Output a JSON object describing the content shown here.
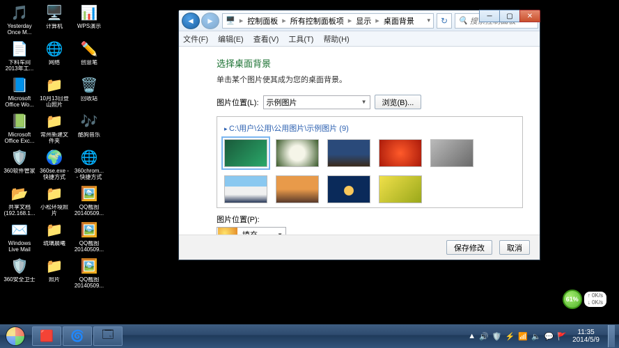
{
  "desktop": {
    "icons": [
      {
        "label": "Yesterday Once M...",
        "color": "#3a7ecb",
        "glyph": "🎵"
      },
      {
        "label": "计算机",
        "color": "#c8d0d8",
        "glyph": "🖥️"
      },
      {
        "label": "WPS演示",
        "color": "#d9542c",
        "glyph": "📊"
      },
      {
        "label": "下料车间2013年工...",
        "color": "#3a7ecb",
        "glyph": "📄"
      },
      {
        "label": "网络",
        "color": "#c8d0d8",
        "glyph": "🌐"
      },
      {
        "label": "创意笔",
        "color": "#2a3a5a",
        "glyph": "✏️"
      },
      {
        "label": "Microsoft Office Wo...",
        "color": "#3a7ecb",
        "glyph": "📘"
      },
      {
        "label": "10月13日登山照片",
        "color": "#f0c96a",
        "glyph": "📁"
      },
      {
        "label": "回收站",
        "color": "#c8d0d8",
        "glyph": "🗑️"
      },
      {
        "label": "Microsoft Office Exc...",
        "color": "#2a8a3a",
        "glyph": "📗"
      },
      {
        "label": "常州新建文件夹",
        "color": "#f0c96a",
        "glyph": "📁"
      },
      {
        "label": "酷狗音乐",
        "color": "#2a8aea",
        "glyph": "🎶"
      },
      {
        "label": "360软件管家",
        "color": "#3a5aea",
        "glyph": "🛡️"
      },
      {
        "label": "360se.exe - 快捷方式",
        "color": "#3aa84a",
        "glyph": "🌍"
      },
      {
        "label": "360chrom... - 快捷方式",
        "color": "#e8a83a",
        "glyph": "🌐"
      },
      {
        "label": "共享文档(192.168.1...",
        "color": "#3a7ecb",
        "glyph": "📂"
      },
      {
        "label": "小松环境照片",
        "color": "#f0c96a",
        "glyph": "📁"
      },
      {
        "label": "QQ截图20140509...",
        "color": "#7aa8d8",
        "glyph": "🖼️"
      },
      {
        "label": "Windows Live Mail",
        "color": "#3a7ecb",
        "glyph": "✉️"
      },
      {
        "label": "琉璃晨曦",
        "color": "#f0c96a",
        "glyph": "📁"
      },
      {
        "label": "QQ截图20140509...",
        "color": "#7aa8d8",
        "glyph": "🖼️"
      },
      {
        "label": "360安全卫士",
        "color": "#3aa84a",
        "glyph": "🛡️"
      },
      {
        "label": "照片",
        "color": "#f0c96a",
        "glyph": "📁"
      },
      {
        "label": "QQ截图20140509...",
        "color": "#7aa8d8",
        "glyph": "🖼️"
      }
    ]
  },
  "dialog": {
    "breadcrumb": [
      "控制面板",
      "所有控制面板项",
      "显示",
      "桌面背景"
    ],
    "search_placeholder": "搜索控制面板",
    "menu": [
      "文件(F)",
      "编辑(E)",
      "查看(V)",
      "工具(T)",
      "帮助(H)"
    ],
    "heading": "选择桌面背景",
    "subtext": "单击某个图片使其成为您的桌面背景。",
    "loc_label": "图片位置(L):",
    "loc_value": "示例图片",
    "browse_btn": "浏览(B)...",
    "gallery_path": "C:\\用户\\公用\\公用图片\\示例图片 (9)",
    "thumbs": [
      {
        "bg": "linear-gradient(135deg,#1a5a3a,#2aa86a)",
        "selected": true
      },
      {
        "bg": "radial-gradient(circle,#f5f5e8 30%,#3a5a2a)"
      },
      {
        "bg": "linear-gradient(#2a4a7a 55%,#3a2a1a)"
      },
      {
        "bg": "radial-gradient(circle,#ff5a2a,#aa1a0a)"
      },
      {
        "bg": "linear-gradient(135deg,#bababa,#6a6a6a)"
      },
      {
        "bg": "linear-gradient(#8ac8f0 40%,#f0f0f0 40% 70%,#2a3a5a)"
      },
      {
        "bg": "linear-gradient(#e89a4a 50%,#5a3a2a)"
      },
      {
        "bg": "radial-gradient(circle at 50% 55%,#fac85a 18%,#0a2a5a 20%)"
      },
      {
        "bg": "linear-gradient(135deg,#f0e04a,#9aa81a)"
      }
    ],
    "pos_label": "图片位置(P):",
    "fill_label": "填充",
    "save_btn": "保存修改",
    "cancel_btn": "取消"
  },
  "battery": {
    "pct": "61%",
    "up": "0K/s",
    "down": "0K/s"
  },
  "taskbar": {
    "tray_icons": [
      "▲",
      "🔊",
      "🛡️",
      "⚡",
      "📶",
      "🔈",
      "💬",
      "🚩"
    ],
    "time": "11:35",
    "date": "2014/5/9"
  }
}
